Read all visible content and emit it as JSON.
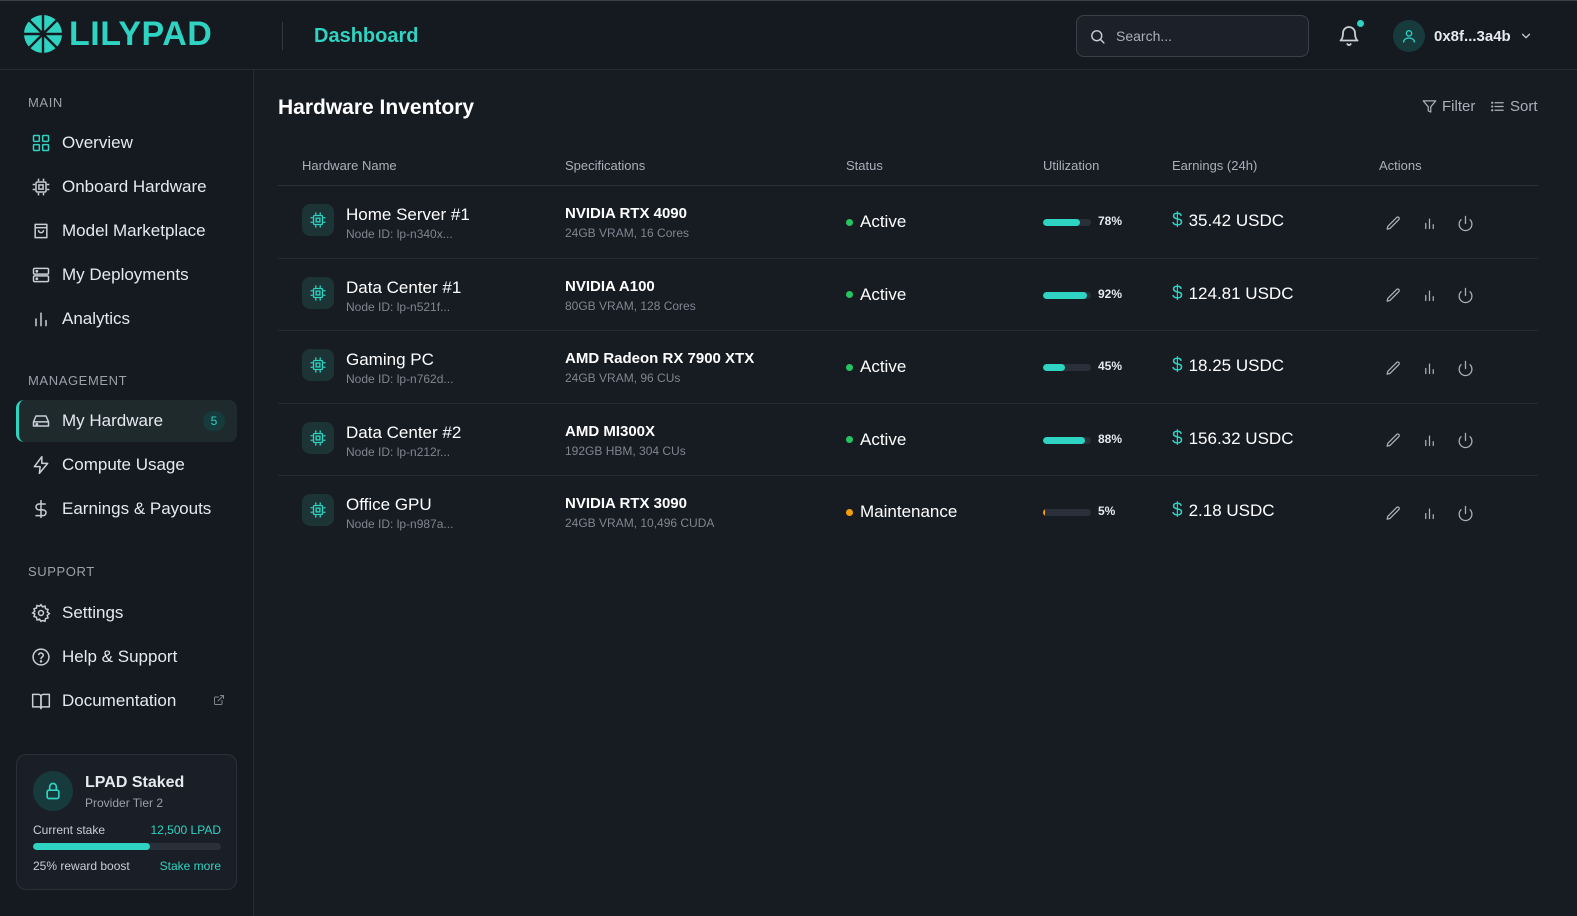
{
  "app": {
    "logo_text": "LILYPAD",
    "page_title": "Dashboard"
  },
  "colors": {
    "accent": "#2fd3c2",
    "active": "#22c55e",
    "maintenance": "#f59e0b",
    "background": "#171b22"
  },
  "header": {
    "search_placeholder": "Search...",
    "notification_icon": "bell-icon",
    "user": {
      "address": "0x8f...3a4b",
      "icon": "user-icon"
    }
  },
  "sidebar": {
    "sections": [
      {
        "label": "MAIN"
      },
      {
        "label": "MANAGEMENT"
      },
      {
        "label": "SUPPORT"
      }
    ],
    "items": [
      {
        "label": "Overview",
        "icon": "grid-icon"
      },
      {
        "label": "Onboard Hardware",
        "icon": "chip-icon"
      },
      {
        "label": "Model Marketplace",
        "icon": "shopping-bag-icon"
      },
      {
        "label": "My Deployments",
        "icon": "server-icon"
      },
      {
        "label": "Analytics",
        "icon": "bar-chart-icon"
      },
      {
        "label": "My Hardware",
        "icon": "hard-drive-icon",
        "badge": "5",
        "active": true
      },
      {
        "label": "Compute Usage",
        "icon": "zap-icon"
      },
      {
        "label": "Earnings & Payouts",
        "icon": "dollar-icon"
      },
      {
        "label": "Settings",
        "icon": "gear-icon"
      },
      {
        "label": "Help & Support",
        "icon": "help-circle-icon"
      },
      {
        "label": "Documentation",
        "icon": "book-icon",
        "external": true
      }
    ],
    "stake": {
      "title": "LPAD Staked",
      "tier": "Provider Tier 2",
      "stake_label": "Current stake",
      "stake_value": "12,500 LPAD",
      "progress": 0.62,
      "boost": "25% reward boost",
      "cta": "Stake more"
    }
  },
  "main": {
    "title": "Hardware Inventory",
    "filter_label": "Filter",
    "sort_label": "Sort",
    "columns": [
      "Hardware Name",
      "Specifications",
      "Status",
      "Utilization",
      "Earnings (24h)",
      "Actions"
    ],
    "rows": [
      {
        "name": "Home Server #1",
        "node": "Node ID: lp-n340x...",
        "spec": "NVIDIA RTX 4090",
        "spec_detail": "24GB VRAM, 16 Cores",
        "status": "Active",
        "status_kind": "active",
        "util": 78,
        "util_label": "78%",
        "earnings": "35.42 USDC"
      },
      {
        "name": "Data Center #1",
        "node": "Node ID: lp-n521f...",
        "spec": "NVIDIA A100",
        "spec_detail": "80GB VRAM, 128 Cores",
        "status": "Active",
        "status_kind": "active",
        "util": 92,
        "util_label": "92%",
        "earnings": "124.81 USDC"
      },
      {
        "name": "Gaming PC",
        "node": "Node ID: lp-n762d...",
        "spec": "AMD Radeon RX 7900 XTX",
        "spec_detail": "24GB VRAM, 96 CUs",
        "status": "Active",
        "status_kind": "active",
        "util": 45,
        "util_label": "45%",
        "earnings": "18.25 USDC"
      },
      {
        "name": "Data Center #2",
        "node": "Node ID: lp-n212r...",
        "spec": "AMD MI300X",
        "spec_detail": "192GB HBM, 304 CUs",
        "status": "Active",
        "status_kind": "active",
        "util": 88,
        "util_label": "88%",
        "earnings": "156.32 USDC"
      },
      {
        "name": "Office GPU",
        "node": "Node ID: lp-n987a...",
        "spec": "NVIDIA RTX 3090",
        "spec_detail": "24GB VRAM, 10,496 CUDA",
        "status": "Maintenance",
        "status_kind": "maintenance",
        "util": 5,
        "util_label": "5%",
        "earnings": "2.18 USDC"
      }
    ]
  }
}
